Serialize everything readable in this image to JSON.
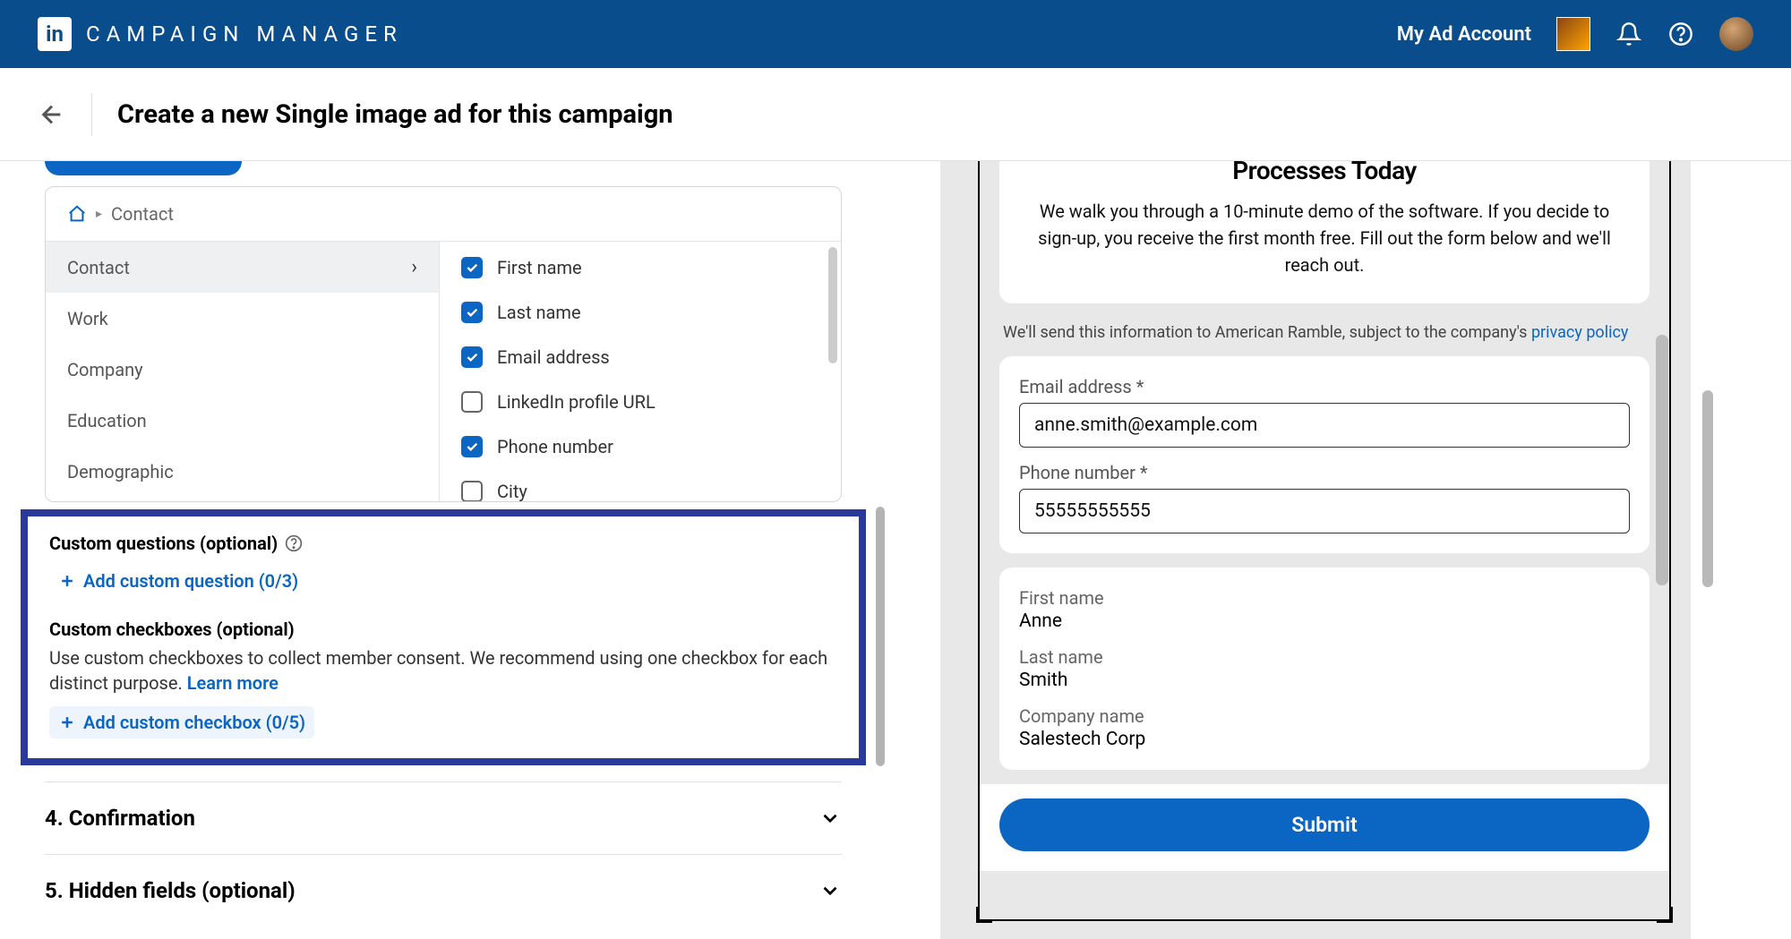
{
  "topbar": {
    "app_name": "CAMPAIGN MANAGER",
    "account_label": "My Ad Account"
  },
  "page": {
    "title": "Create a new Single image ad for this campaign"
  },
  "breadcrumb": {
    "current": "Contact"
  },
  "categories": [
    "Contact",
    "Work",
    "Company",
    "Education",
    "Demographic"
  ],
  "fields": [
    {
      "label": "First name",
      "checked": true
    },
    {
      "label": "Last name",
      "checked": true
    },
    {
      "label": "Email address",
      "checked": true
    },
    {
      "label": "LinkedIn profile URL",
      "checked": false
    },
    {
      "label": "Phone number",
      "checked": true
    },
    {
      "label": "City",
      "checked": false
    }
  ],
  "custom_q": {
    "title": "Custom questions (optional)",
    "add": "Add custom question (0/3)"
  },
  "custom_cb": {
    "title": "Custom checkboxes (optional)",
    "desc": "Use custom checkboxes to collect member consent. We recommend using one checkbox for each distinct purpose. ",
    "learn": "Learn more",
    "add": "Add custom checkbox (0/5)"
  },
  "accordion": {
    "r4": "4.  Confirmation",
    "r5": "5.  Hidden fields (optional)"
  },
  "preview": {
    "headline_partial": "Processes Today",
    "subhead": "We walk you through a 10-minute demo of the software. If you decide to sign-up, you receive the first month free. Fill out the form below and we'll reach out.",
    "disclosure_pre": "We'll send this information to American Ramble, subject to the company's ",
    "disclosure_link": "privacy policy",
    "email_label": "Email address *",
    "email_value": "anne.smith@example.com",
    "phone_label": "Phone number *",
    "phone_value": "55555555555",
    "fn_label": "First name",
    "fn_value": "Anne",
    "ln_label": "Last name",
    "ln_value": "Smith",
    "co_label": "Company name",
    "co_value": "Salestech Corp",
    "submit": "Submit"
  }
}
